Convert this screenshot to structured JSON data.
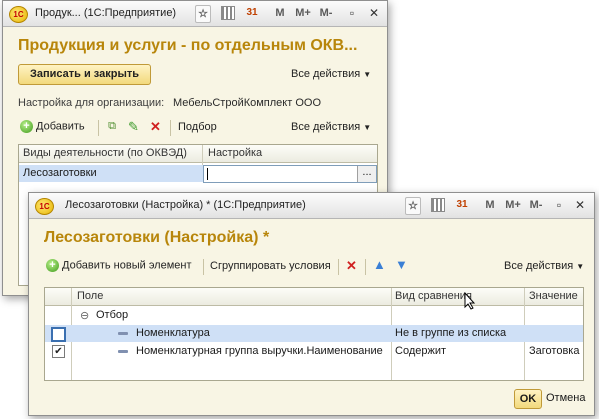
{
  "main_window": {
    "title": "Продук... (1С:Предприятие)",
    "titlebar_buttons": [
      "M",
      "M+",
      "M-"
    ],
    "form_title": "Продукция и услуги - по отдельным ОКВ...",
    "save_close_label": "Записать и закрыть",
    "all_actions_label": "Все действия",
    "org_label": "Настройка для организации:",
    "org_value": "МебельСтройКомплект ООО",
    "toolbar": {
      "add_label": "Добавить",
      "selection_label": "Подбор",
      "all_actions_label": "Все действия"
    },
    "table": {
      "columns": [
        "Виды деятельности (по ОКВЭД)",
        "Настройка"
      ],
      "rows": [
        {
          "activity": "Лесозаготовки",
          "setting": ""
        }
      ],
      "ellipsis": "..."
    }
  },
  "dialog_window": {
    "title": "Лесозаготовки (Настройка) * (1С:Предприятие)",
    "titlebar_buttons": [
      "M",
      "M+",
      "M-"
    ],
    "form_title": "Лесозаготовки (Настройка) *",
    "toolbar": {
      "add_element_label": "Добавить новый элемент",
      "group_label": "Сгруппировать условия",
      "all_actions_label": "Все действия"
    },
    "table": {
      "columns": [
        "Поле",
        "Вид сравнения",
        "Значение"
      ],
      "group_row": "Отбор",
      "rows": [
        {
          "checked": false,
          "field": "Номенклатура",
          "comparison": "Не в группе из списка",
          "value": ""
        },
        {
          "checked": true,
          "field": "Номенклатурная группа выручки.Наименование",
          "comparison": "Содержит",
          "value": "Заготовка"
        }
      ]
    },
    "ok_label": "OK",
    "cancel_label": "Отмена"
  },
  "colors": {
    "title_accent": "#b8860b",
    "window_bg": "#f8f5e4",
    "selection": "#cfe0f6"
  }
}
